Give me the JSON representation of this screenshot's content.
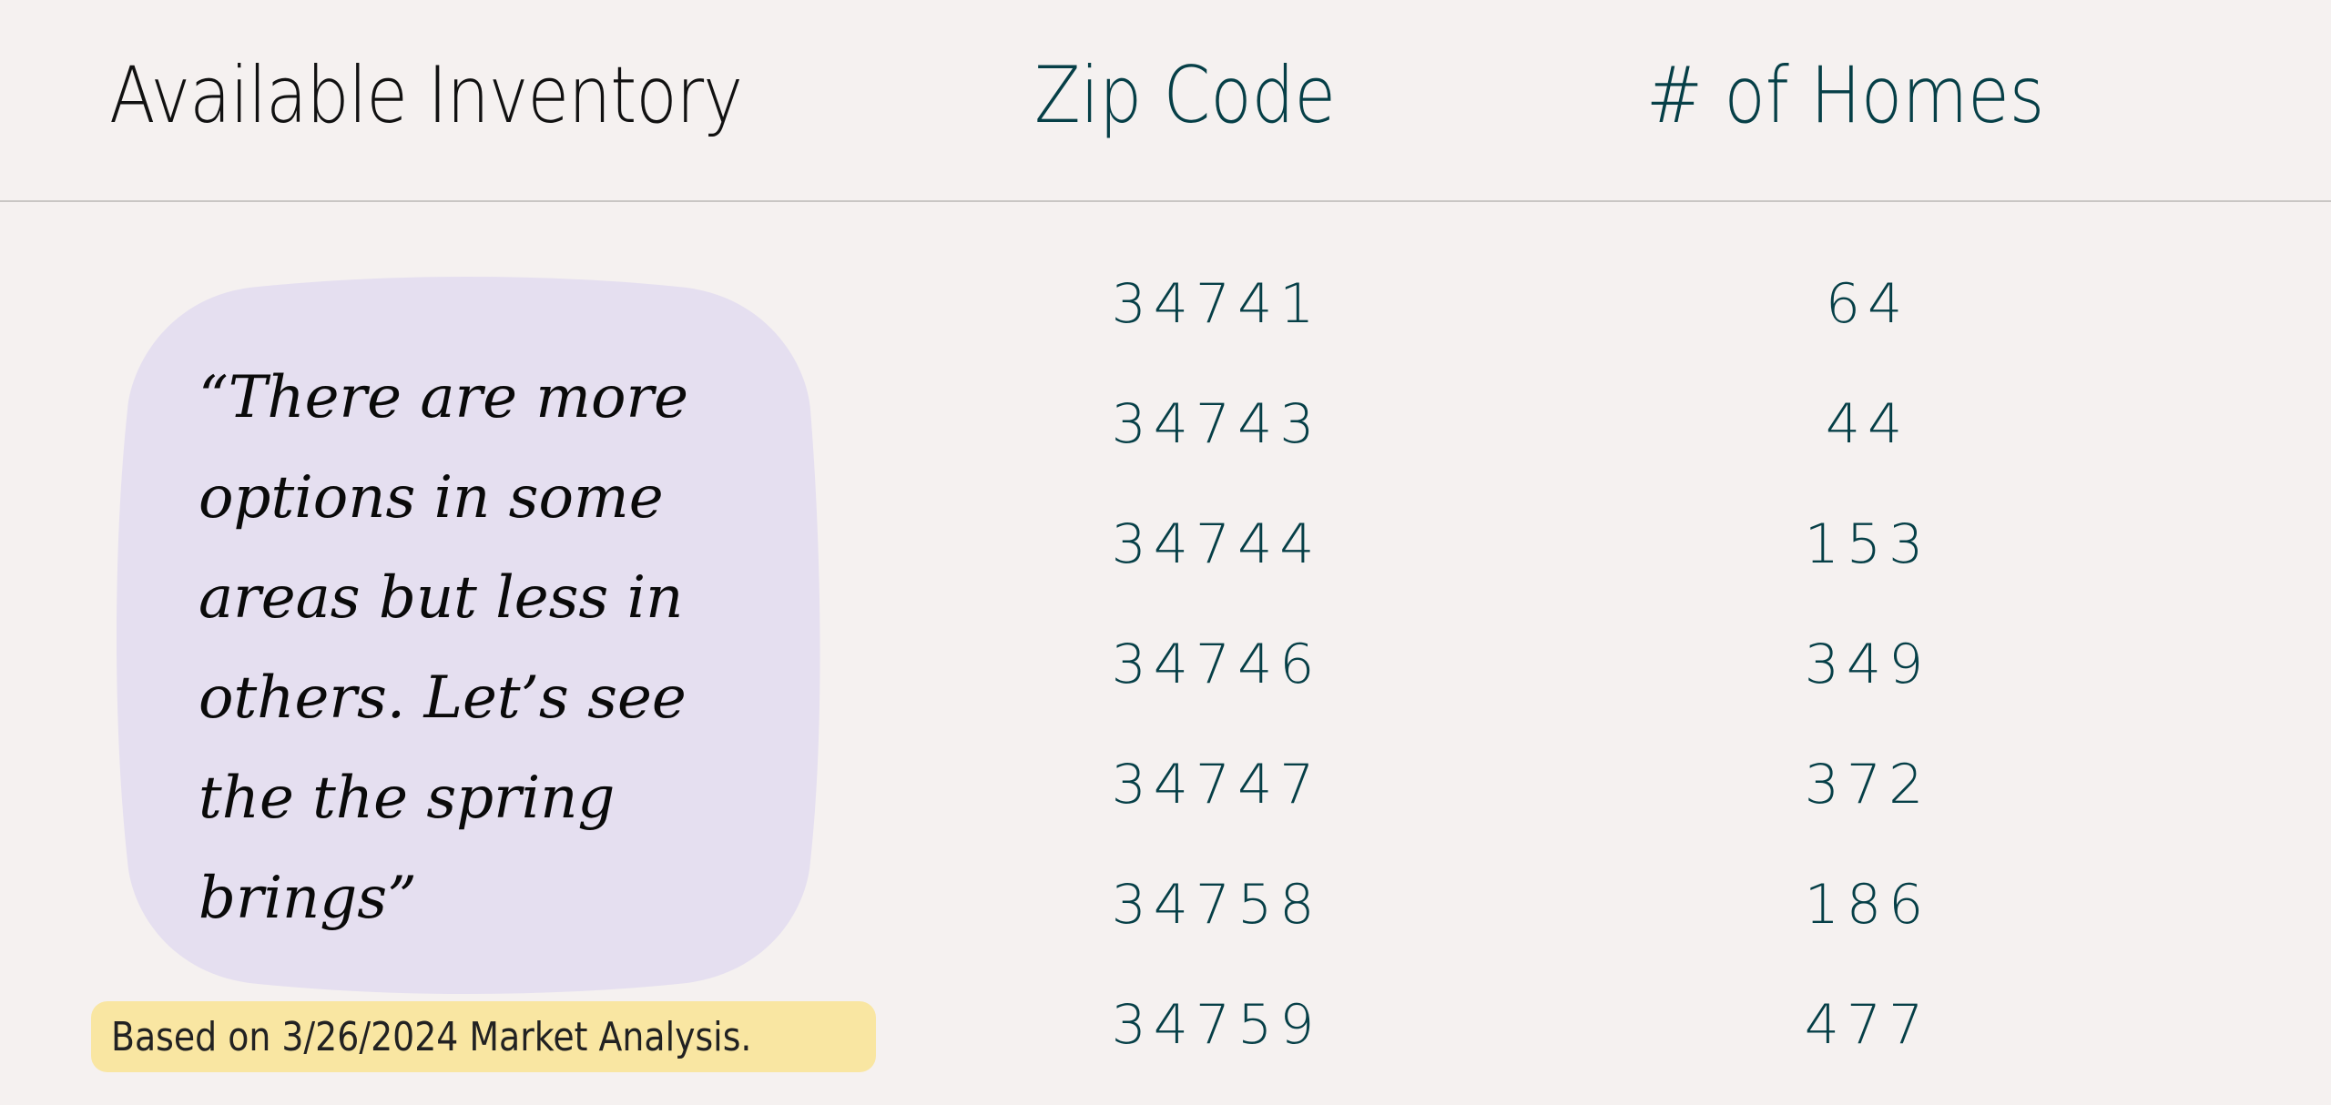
{
  "colors": {
    "background": "#f5f1f0",
    "accent_teal": "#063f47",
    "title": "#111111",
    "quote_bubble": "#e5dff0",
    "footnote_bg": "#f9e6a2",
    "divider": "#c9c6c4"
  },
  "header": {
    "title": "Available Inventory",
    "columns": [
      "Zip Code",
      "# of Homes"
    ]
  },
  "quote": {
    "text": "“There are more options in some areas but less in others. Let’s see the the spring brings”"
  },
  "footnote": {
    "text": "Based on 3/26/2024 Market Analysis."
  },
  "table": {
    "rows": [
      {
        "zip": "34741",
        "homes": "64"
      },
      {
        "zip": "34743",
        "homes": "44"
      },
      {
        "zip": "34744",
        "homes": "153"
      },
      {
        "zip": "34746",
        "homes": "349"
      },
      {
        "zip": "34747",
        "homes": "372"
      },
      {
        "zip": "34758",
        "homes": "186"
      },
      {
        "zip": "34759",
        "homes": "477"
      }
    ]
  }
}
